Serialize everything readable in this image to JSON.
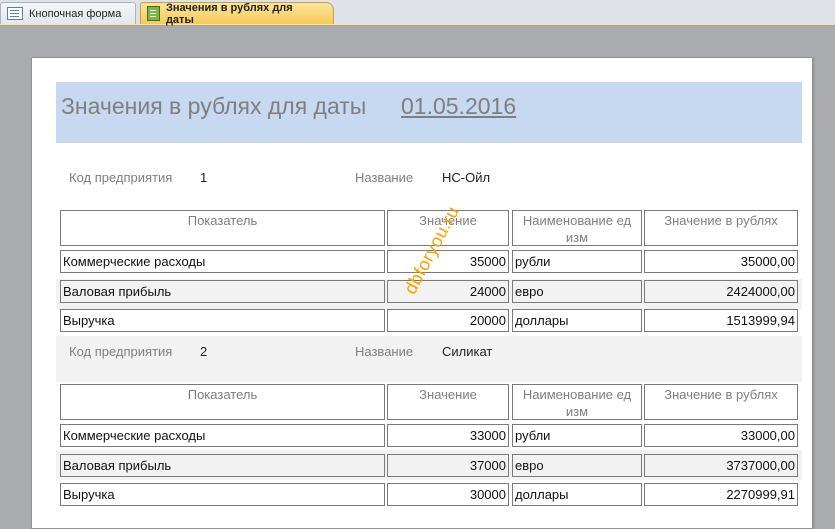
{
  "tabs": [
    {
      "label": "Кнопочная форма",
      "icon": "form-icon",
      "active": false
    },
    {
      "label": "Значения в рублях для даты",
      "icon": "report-icon",
      "active": true
    }
  ],
  "report": {
    "title": "Значения в рублях для даты",
    "date": "01.05.2016",
    "label_code": "Код  предприятия",
    "label_name": "Название",
    "headers": [
      "Показатель",
      "Значение",
      "Наименование ед изм",
      "Значение в рублях"
    ],
    "groups": [
      {
        "code": "1",
        "name": "НС-Ойл",
        "rows": [
          [
            "Коммерческие расходы",
            "35000",
            "рубли",
            "35000,00"
          ],
          [
            "Валовая прибыль",
            "24000",
            "евро",
            "2424000,00"
          ],
          [
            "Выручка",
            "20000",
            "доллары",
            "1513999,94"
          ]
        ]
      },
      {
        "code": "2",
        "name": "Силикат",
        "rows": [
          [
            "Коммерческие расходы",
            "33000",
            "рубли",
            "33000,00"
          ],
          [
            "Валовая прибыль",
            "37000",
            "евро",
            "3737000,00"
          ],
          [
            "Выручка",
            "30000",
            "доллары",
            "2270999,91"
          ]
        ]
      }
    ]
  },
  "watermark": "dbforyou.ru",
  "colors": {
    "banner": "#c6d9f1",
    "active_tab": "#f7c95d",
    "watermark": "#f4a300"
  }
}
